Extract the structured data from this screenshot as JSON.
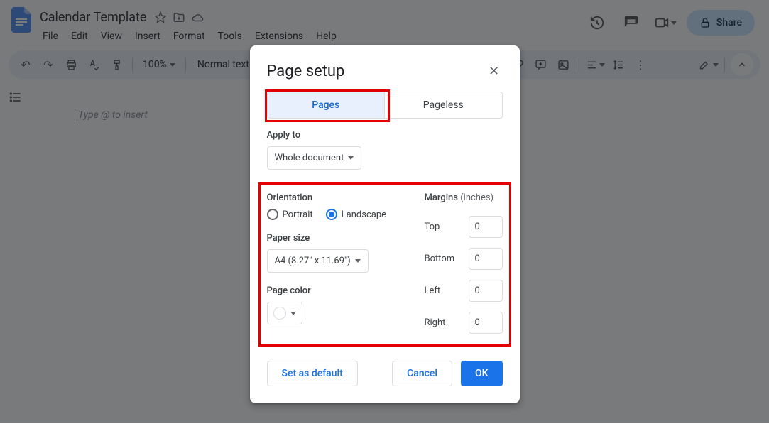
{
  "header": {
    "doc_title": "Calendar Template",
    "menus": [
      "File",
      "Edit",
      "View",
      "Insert",
      "Format",
      "Tools",
      "Extensions",
      "Help"
    ],
    "share_label": "Share"
  },
  "toolbar": {
    "zoom": "100%",
    "style": "Normal text"
  },
  "document": {
    "placeholder": "Type @ to insert"
  },
  "modal": {
    "title": "Page setup",
    "tabs": {
      "pages": "Pages",
      "pageless": "Pageless"
    },
    "apply_to_label": "Apply to",
    "apply_to_value": "Whole document",
    "orientation_label": "Orientation",
    "orientation": {
      "portrait": "Portrait",
      "landscape": "Landscape",
      "selected": "landscape"
    },
    "paper_size_label": "Paper size",
    "paper_size_value": "A4 (8.27\" x 11.69\")",
    "page_color_label": "Page color",
    "page_color_value": "#ffffff",
    "margins_label": "Margins",
    "margins_unit": "(inches)",
    "margins": {
      "top_label": "Top",
      "top": "0",
      "bottom_label": "Bottom",
      "bottom": "0",
      "left_label": "Left",
      "left": "0",
      "right_label": "Right",
      "right": "0"
    },
    "set_default": "Set as default",
    "cancel": "Cancel",
    "ok": "OK"
  }
}
